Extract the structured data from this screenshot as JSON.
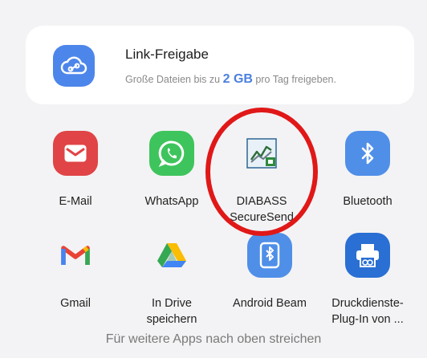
{
  "link_share": {
    "title": "Link-Freigabe",
    "desc_before": "Große Dateien bis zu ",
    "desc_highlight": "2 GB",
    "desc_after": " pro Tag freigeben."
  },
  "apps": [
    {
      "label": "E-Mail",
      "icon": "email-icon",
      "color": "#e04446"
    },
    {
      "label": "WhatsApp",
      "icon": "whatsapp-icon",
      "color": "#3ec45c"
    },
    {
      "label": "DIABASS SecureSend",
      "icon": "diabass-icon",
      "color": "#ffffff"
    },
    {
      "label": "Bluetooth",
      "icon": "bluetooth-icon",
      "color": "#4f8fe8"
    },
    {
      "label": "Gmail",
      "icon": "gmail-icon",
      "color": "#ffffff"
    },
    {
      "label": "In Drive speichern",
      "icon": "drive-icon",
      "color": "#ffffff"
    },
    {
      "label": "Android Beam",
      "icon": "android-beam-icon",
      "color": "#4f8fe8"
    },
    {
      "label": "Druckdienste-Plug-In von ...",
      "icon": "print-service-icon",
      "color": "#2a6fd3"
    }
  ],
  "footer": "Für weitere Apps nach oben streichen"
}
